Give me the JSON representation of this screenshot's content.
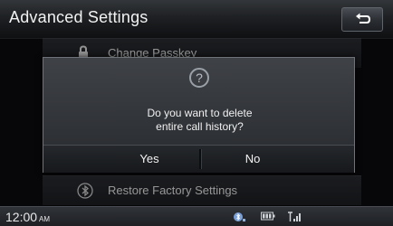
{
  "header": {
    "title": "Advanced Settings",
    "back_icon": "return-arrow-icon"
  },
  "list": {
    "items": [
      {
        "label": "Change Passkey",
        "icon": "lock-icon"
      },
      {
        "label": "Restore Factory Settings",
        "icon": "bluetooth-icon"
      }
    ]
  },
  "dialog": {
    "icon": "question-icon",
    "icon_glyph": "?",
    "message_line1": "Do you want to delete",
    "message_line2": "entire call history?",
    "yes_label": "Yes",
    "no_label": "No"
  },
  "status_bar": {
    "time": "12:00",
    "ampm": "AM",
    "icons": [
      "bluetooth-status-icon",
      "battery-icon",
      "signal-icon"
    ]
  },
  "colors": {
    "background": "#0b0c0e",
    "text": "#f0f0f0",
    "dialog_border": "#6e7279"
  }
}
